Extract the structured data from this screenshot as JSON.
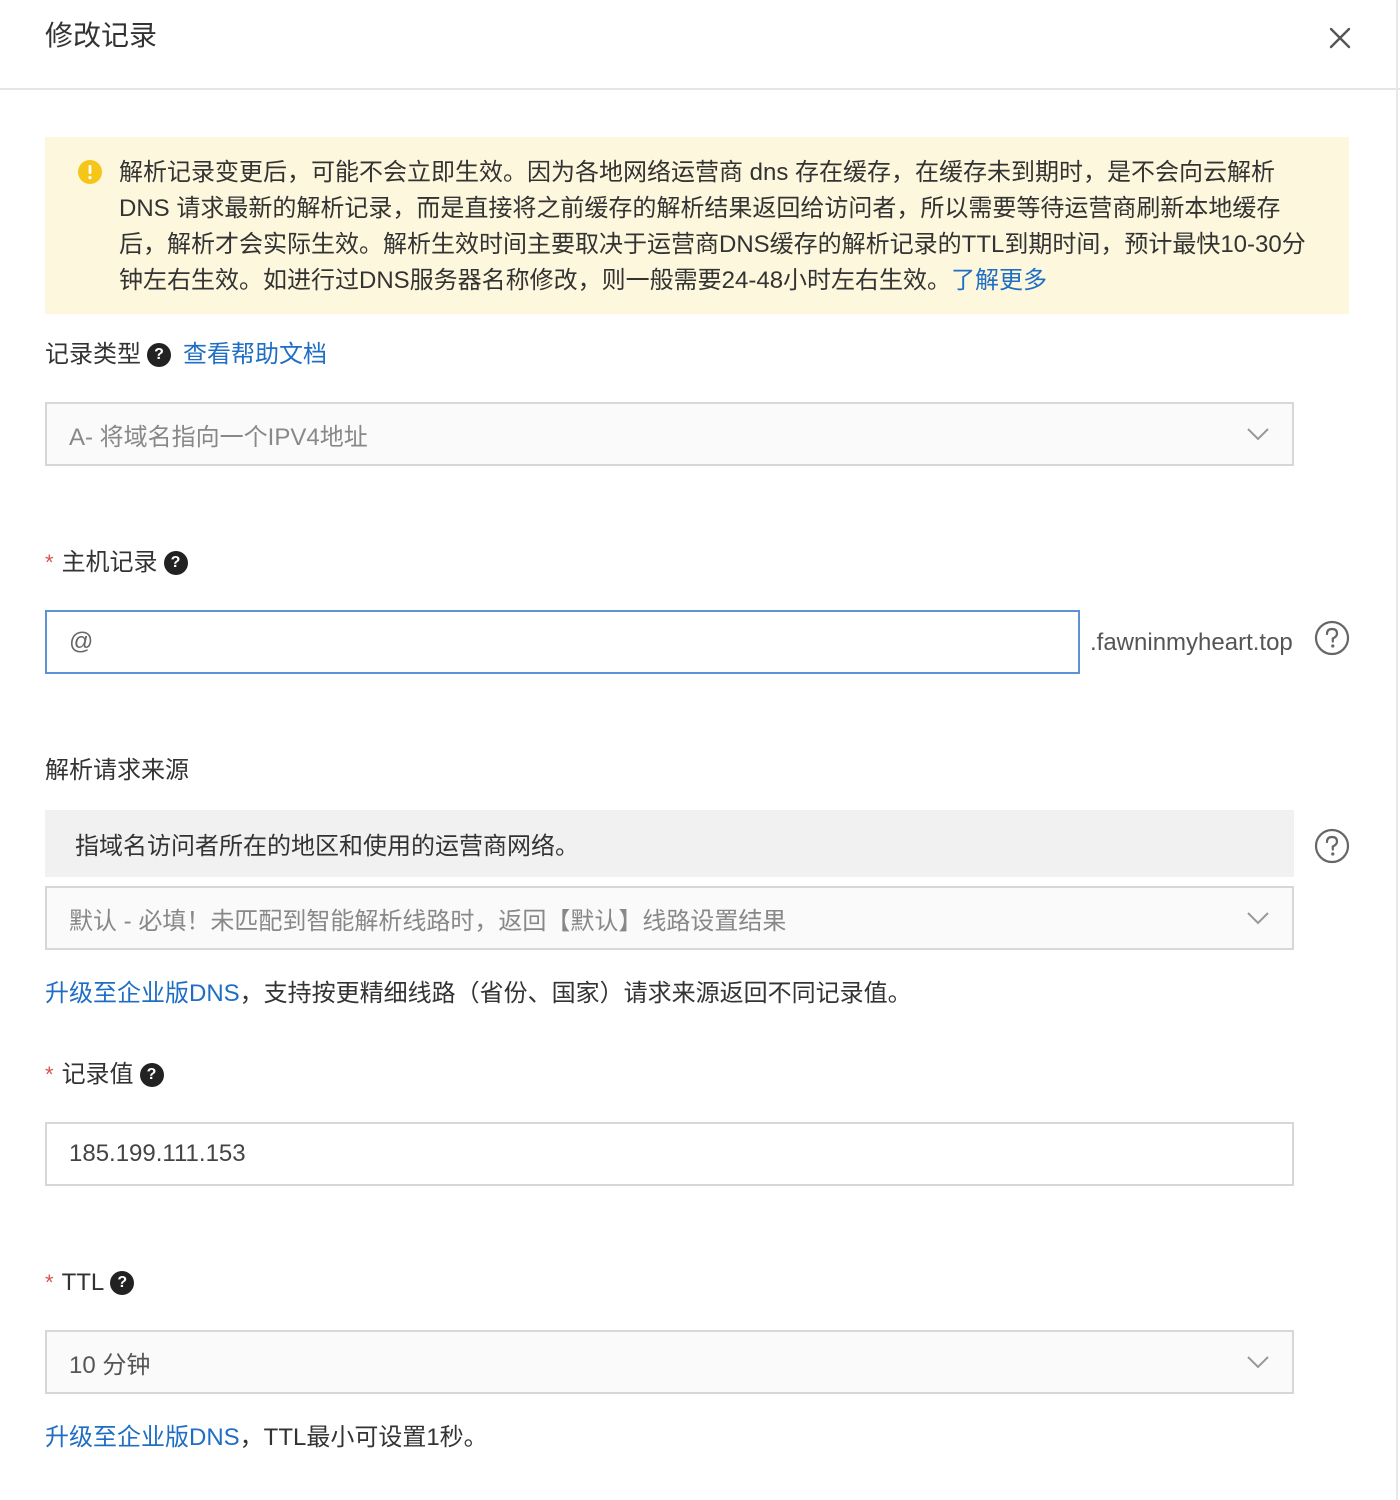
{
  "dialog": {
    "title": "修改记录"
  },
  "notice": {
    "text": "解析记录变更后，可能不会立即生效。因为各地网络运营商 dns 存在缓存，在缓存未到期时，是不会向云解析 DNS 请求最新的解析记录，而是直接将之前缓存的解析结果返回给访问者，所以需要等待运营商刷新本地缓存后，解析才会实际生效。解析生效时间主要取决于运营商DNS缓存的解析记录的TTL到期时间，预计最快10-30分钟左右生效。如进行过DNS服务器名称修改，则一般需要24-48小时左右生效。",
    "link": "了解更多"
  },
  "record_type": {
    "label": "记录类型",
    "help_link": "查看帮助文档",
    "value": "A- 将域名指向一个IPV4地址"
  },
  "host_record": {
    "required_mark": "*",
    "label": "主机记录",
    "value": "@",
    "suffix": ".fawninmyheart.top"
  },
  "source": {
    "label": "解析请求来源",
    "hint": "指域名访问者所在的地区和使用的运营商网络。",
    "value": "默认 - 必填！未匹配到智能解析线路时，返回【默认】线路设置结果",
    "upgrade_link": "升级至企业版DNS",
    "upgrade_text": "，支持按更精细线路（省份、国家）请求来源返回不同记录值。"
  },
  "record_value": {
    "required_mark": "*",
    "label": "记录值",
    "value": "185.199.111.153"
  },
  "ttl": {
    "required_mark": "*",
    "label": "TTL",
    "value": "10 分钟",
    "upgrade_link": "升级至企业版DNS",
    "upgrade_text": "，TTL最小可设置1秒。"
  },
  "colors": {
    "link": "#1f6ec5",
    "notice_bg": "#fdf8dd",
    "warning_icon": "#f5c518",
    "required": "#d9534f",
    "active_border": "#5b93d6"
  },
  "icons": [
    "close-icon",
    "warning-icon",
    "question-badge-icon",
    "chevron-down-icon",
    "help-circle-icon"
  ]
}
